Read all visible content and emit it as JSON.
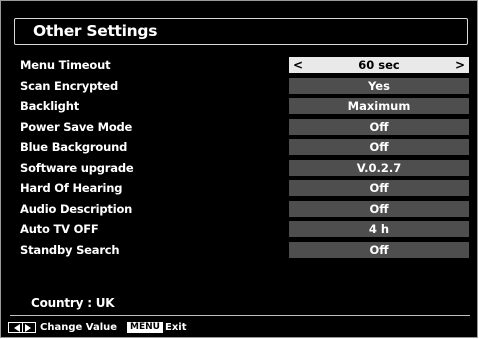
{
  "title": "Other Settings",
  "settings": [
    {
      "label": "Menu Timeout",
      "value": "60 sec"
    },
    {
      "label": "Scan Encrypted",
      "value": "Yes"
    },
    {
      "label": "Backlight",
      "value": "Maximum"
    },
    {
      "label": "Power Save Mode",
      "value": "Off"
    },
    {
      "label": "Blue Background",
      "value": "Off"
    },
    {
      "label": "Software upgrade",
      "value": "V.0.2.7"
    },
    {
      "label": "Hard Of Hearing",
      "value": "Off"
    },
    {
      "label": "Audio Description",
      "value": "Off"
    },
    {
      "label": "Auto TV OFF",
      "value": "4 h"
    },
    {
      "label": "Standby Search",
      "value": "Off"
    }
  ],
  "selected_arrows": {
    "left": "<",
    "right": ">"
  },
  "country": "Country : UK",
  "footer": {
    "change_value": "Change Value",
    "menu_key": "MENU",
    "exit": "Exit"
  },
  "icons": {
    "left_right": "left-right-arrows-icon"
  },
  "colors": {
    "background": "#000000",
    "value_cell": "#4e4e4e",
    "selected_cell": "#e9e9e9"
  }
}
